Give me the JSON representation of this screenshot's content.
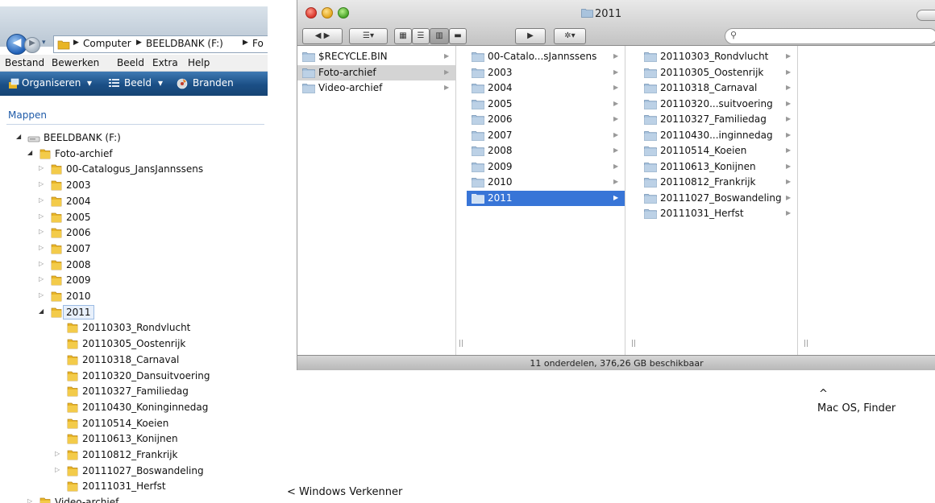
{
  "windows_explorer": {
    "address": {
      "back_label": "◀",
      "forward_label": "▶",
      "recent_label": "▾",
      "crumbs": [
        "Computer",
        "BEELDBANK (F:)",
        "Fo"
      ],
      "separator": "▶"
    },
    "menu": [
      "Bestand",
      "Bewerken",
      "Beeld",
      "Extra",
      "Help"
    ],
    "toolbar": {
      "organize_label": "Organiseren",
      "view_label": "Beeld",
      "burn_label": "Branden",
      "dropdown_glyph": "▾"
    },
    "pane_title": "Mappen",
    "tree": [
      {
        "label": "BEELDBANK (F:)",
        "expander": "◢",
        "icon": "drive-icon"
      },
      {
        "label": "Foto-archief",
        "expander": "◢",
        "icon": "folder-icon"
      },
      {
        "label": "00-Catalogus_JansJannssens",
        "expander": "▷",
        "icon": "folder-icon"
      },
      {
        "label": "2003",
        "expander": "▷",
        "icon": "folder-icon"
      },
      {
        "label": "2004",
        "expander": "▷",
        "icon": "folder-icon"
      },
      {
        "label": "2005",
        "expander": "▷",
        "icon": "folder-icon"
      },
      {
        "label": "2006",
        "expander": "▷",
        "icon": "folder-icon"
      },
      {
        "label": "2007",
        "expander": "▷",
        "icon": "folder-icon"
      },
      {
        "label": "2008",
        "expander": "▷",
        "icon": "folder-icon"
      },
      {
        "label": "2009",
        "expander": "▷",
        "icon": "folder-icon"
      },
      {
        "label": "2010",
        "expander": "▷",
        "icon": "folder-icon"
      },
      {
        "label": "2011",
        "expander": "◢",
        "icon": "folder-icon",
        "selected": true
      },
      {
        "label": "20110303_Rondvlucht",
        "expander": "",
        "icon": "folder-icon"
      },
      {
        "label": "20110305_Oostenrijk",
        "expander": "",
        "icon": "folder-icon"
      },
      {
        "label": "20110318_Carnaval",
        "expander": "",
        "icon": "folder-icon"
      },
      {
        "label": "20110320_Dansuitvoering",
        "expander": "",
        "icon": "folder-icon"
      },
      {
        "label": "20110327_Familiedag",
        "expander": "",
        "icon": "folder-icon"
      },
      {
        "label": "20110430_Koninginnedag",
        "expander": "",
        "icon": "folder-icon"
      },
      {
        "label": "20110514_Koeien",
        "expander": "",
        "icon": "folder-icon"
      },
      {
        "label": "20110613_Konijnen",
        "expander": "",
        "icon": "folder-icon"
      },
      {
        "label": "20110812_Frankrijk",
        "expander": "▷",
        "icon": "folder-icon"
      },
      {
        "label": "20111027_Boswandeling",
        "expander": "▷",
        "icon": "folder-icon"
      },
      {
        "label": "20111031_Herfst",
        "expander": "",
        "icon": "folder-icon"
      },
      {
        "label": "Video-archief",
        "expander": "▷",
        "icon": "folder-icon"
      }
    ]
  },
  "finder": {
    "window_title": "2011",
    "toolbar": {
      "back_forward": "◀ ▶",
      "list_menu": "☰▾",
      "view_icons": "▦",
      "view_list": "☰",
      "view_columns": "▥",
      "view_coverflow": "▬",
      "quicklook": "▶",
      "action": "✲▾",
      "search_glyph": "⚲",
      "search_value": ""
    },
    "columns": [
      {
        "items": [
          {
            "label": "$RECYCLE.BIN",
            "arrow": "▶"
          },
          {
            "label": "Foto-archief",
            "arrow": "▶",
            "active": true
          },
          {
            "label": "Video-archief",
            "arrow": "▶"
          }
        ]
      },
      {
        "items": [
          {
            "label": "00-Catalo...sJannssens",
            "arrow": "▶"
          },
          {
            "label": "2003",
            "arrow": "▶"
          },
          {
            "label": "2004",
            "arrow": "▶"
          },
          {
            "label": "2005",
            "arrow": "▶"
          },
          {
            "label": "2006",
            "arrow": "▶"
          },
          {
            "label": "2007",
            "arrow": "▶"
          },
          {
            "label": "2008",
            "arrow": "▶"
          },
          {
            "label": "2009",
            "arrow": "▶"
          },
          {
            "label": "2010",
            "arrow": "▶"
          },
          {
            "label": "2011",
            "arrow": "▶",
            "selected": true
          }
        ]
      },
      {
        "items": [
          {
            "label": "20110303_Rondvlucht",
            "arrow": "▶"
          },
          {
            "label": "20110305_Oostenrijk",
            "arrow": "▶"
          },
          {
            "label": "20110318_Carnaval",
            "arrow": "▶"
          },
          {
            "label": "20110320...suitvoering",
            "arrow": "▶"
          },
          {
            "label": "20110327_Familiedag",
            "arrow": "▶"
          },
          {
            "label": "20110430...inginnedag",
            "arrow": "▶"
          },
          {
            "label": "20110514_Koeien",
            "arrow": "▶"
          },
          {
            "label": "20110613_Konijnen",
            "arrow": "▶"
          },
          {
            "label": "20110812_Frankrijk",
            "arrow": "▶"
          },
          {
            "label": "20111027_Boswandeling",
            "arrow": "▶"
          },
          {
            "label": "20111031_Herfst",
            "arrow": "▶"
          }
        ]
      }
    ],
    "column_grip": "||",
    "status": "11 onderdelen, 376,26 GB beschikbaar"
  },
  "captions": {
    "mac_caret": "^",
    "mac": "Mac OS, Finder",
    "windows": "< Windows Verkenner"
  },
  "colors": {
    "finder_selection": "#3875d7",
    "explorer_toolbar": "#1b4f86",
    "folder_yellow": "#e8b526",
    "mac_folder_blue": "#a9c3dd"
  }
}
